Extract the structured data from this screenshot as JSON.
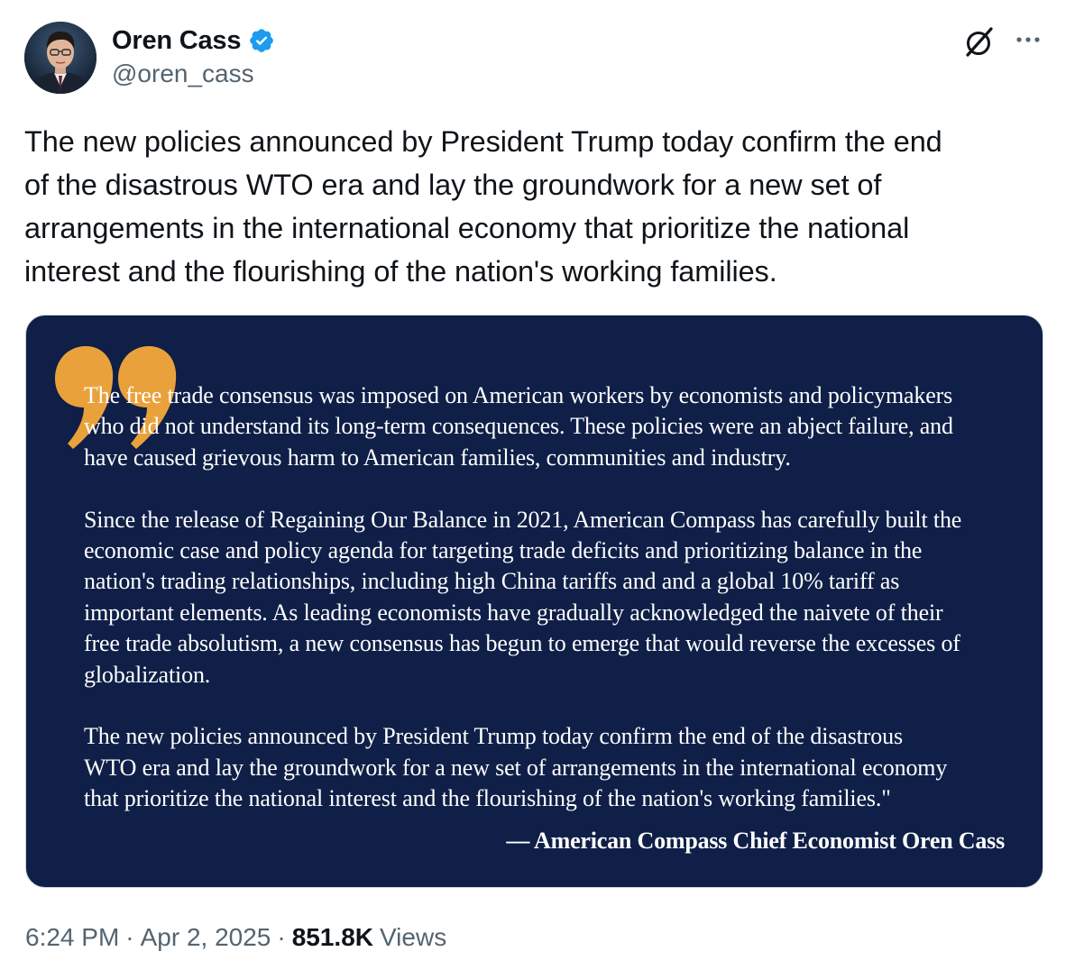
{
  "author": {
    "display_name": "Oren Cass",
    "handle": "@oren_cass",
    "verified": true,
    "verified_color": "#1d9bf0",
    "avatar_icon": "avatar-photo"
  },
  "header_icons": {
    "grok": "grok-icon",
    "more": "more-icon"
  },
  "tweet": {
    "text": "The new policies announced by President Trump today confirm the end\nof the disastrous WTO era and lay the groundwork for a new set of\narrangements in the international economy that prioritize the national\ninterest and the flourishing of the nation's working families."
  },
  "media": {
    "background_color": "#0f1f47",
    "quote_mark_color": "#e9a23b",
    "paragraphs": [
      "The free trade consensus was imposed on American workers by economists and policymakers\nwho did not understand its long-term consequences. These policies were an abject failure, and\nhave caused grievous harm to American families, communities and industry.",
      "Since the release of Regaining Our Balance in 2021, American Compass has carefully built the\neconomic case and policy agenda for targeting trade deficits and prioritizing balance in the\nnation's trading relationships, including high China tariffs and and a global 10% tariff as\nimportant elements. As leading economists have gradually acknowledged the naivete of their\nfree trade absolutism, a new consensus has begun to emerge that would reverse the excesses of\nglobalization.",
      "The new policies announced by President Trump today confirm the end of the disastrous\nWTO era and lay the groundwork for a new set of arrangements in the international economy\nthat prioritize the national interest and the flourishing of the nation's working families.\""
    ],
    "attribution": "— American Compass Chief Economist Oren Cass"
  },
  "meta": {
    "time": "6:24 PM",
    "date": "Apr 2, 2025",
    "separator": "·",
    "views_count": "851.8K",
    "views_label": "Views"
  }
}
